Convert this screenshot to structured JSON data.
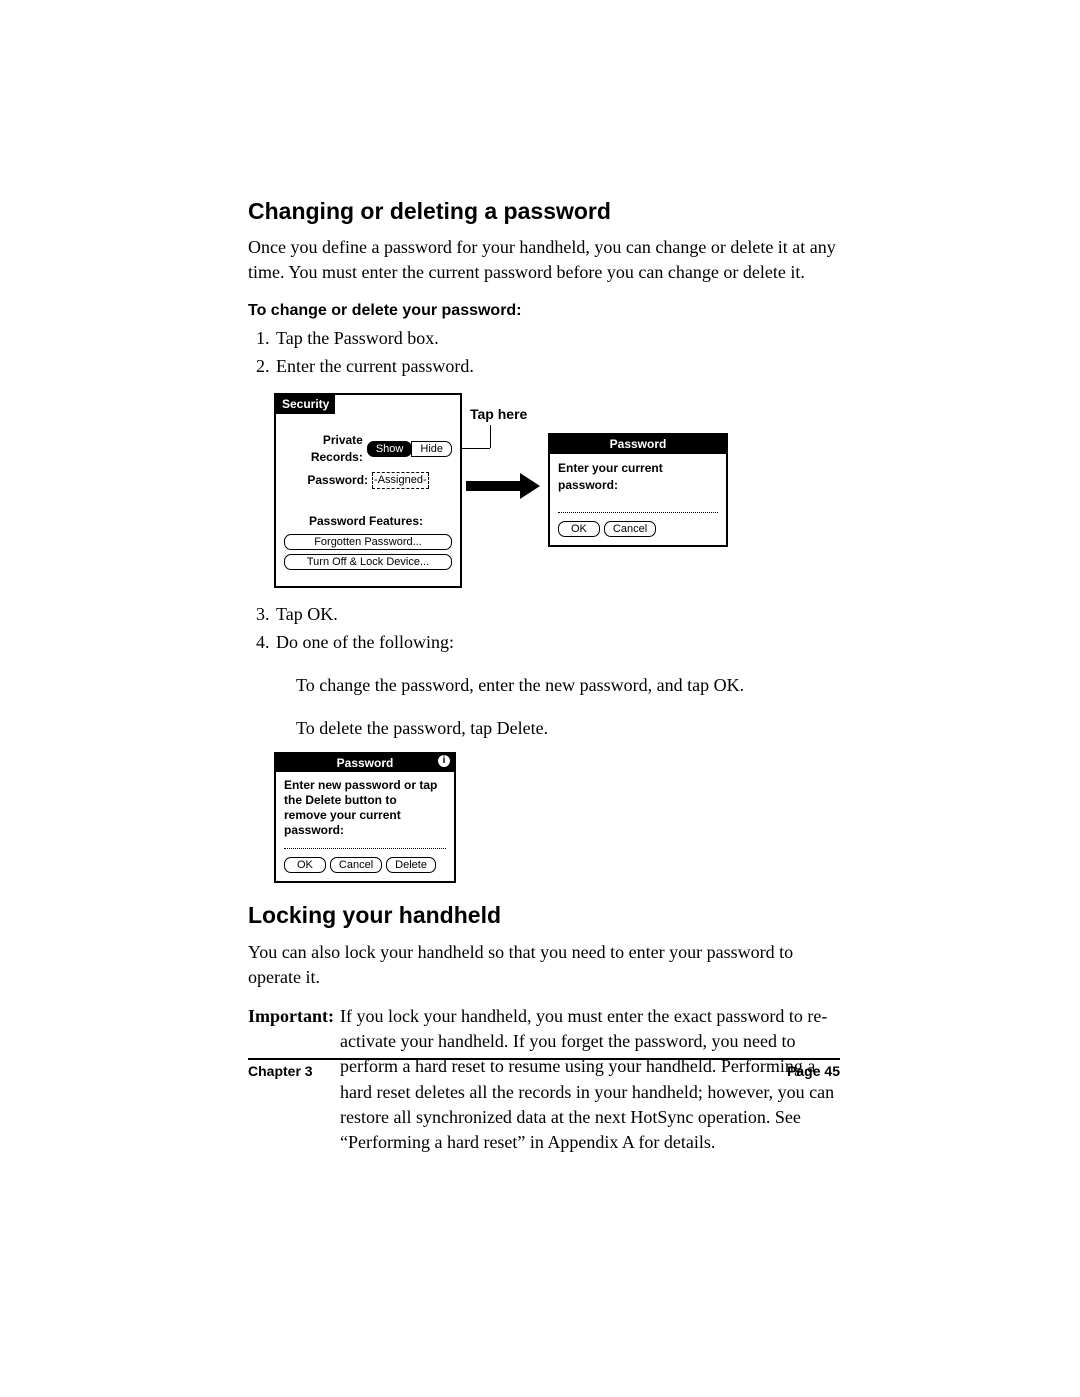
{
  "heading1": "Changing or deleting a password",
  "intro1": "Once you define a password for your handheld, you can change or delete it at any time. You must enter the current password before you can change or delete it.",
  "subhead1": "To change or delete your password:",
  "steps_a": [
    "Tap the Password box.",
    "Enter the current password."
  ],
  "annotation_tap_here": "Tap here",
  "security": {
    "title": "Security",
    "private_records_label": "Private Records:",
    "show": "Show",
    "hide": "Hide",
    "password_label": "Password:",
    "password_value": "-Assigned-",
    "features_label": "Password Features:",
    "forgotten_btn": "Forgotten Password...",
    "turnoff_btn": "Turn Off & Lock Device..."
  },
  "dialog_current": {
    "title": "Password",
    "prompt": "Enter your current password:",
    "ok": "OK",
    "cancel": "Cancel"
  },
  "steps_b": [
    "Tap OK.",
    "Do one of the following:"
  ],
  "sub_change": "To change the password, enter the new password, and tap OK.",
  "sub_delete": "To delete the password, tap Delete.",
  "dialog_new": {
    "title": "Password",
    "prompt": "Enter new password or tap the Delete button to remove your current password:",
    "ok": "OK",
    "cancel": "Cancel",
    "delete": "Delete"
  },
  "heading2": "Locking your handheld",
  "intro2": "You can also lock your handheld so that you need to enter your password to operate it.",
  "important_label": "Important:",
  "important_text": "If you lock your handheld, you must enter the exact password to re-activate your handheld. If you forget the password, you need to perform a hard reset to resume using your handheld. Performing a hard reset deletes all the records in your handheld; however, you can restore all synchronized data at the next HotSync operation. See “Performing a hard reset” in Appendix A for details.",
  "footer_left": "Chapter 3",
  "footer_right": "Page 45"
}
